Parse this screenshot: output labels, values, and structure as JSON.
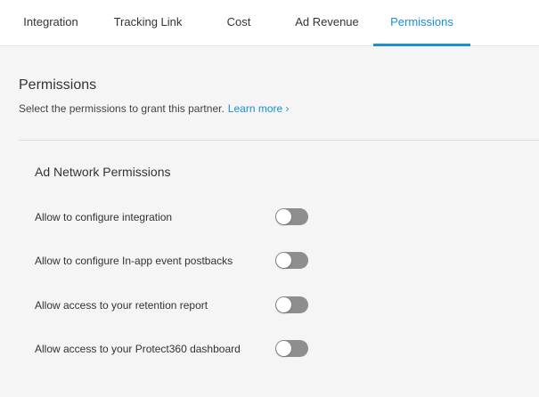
{
  "tabs": [
    {
      "label": "Integration",
      "active": false
    },
    {
      "label": "Tracking Link",
      "active": false
    },
    {
      "label": "Cost",
      "active": false
    },
    {
      "label": "Ad Revenue",
      "active": false
    },
    {
      "label": "Permissions",
      "active": true
    }
  ],
  "header": {
    "title": "Permissions",
    "subtitle": "Select the permissions to grant this partner.",
    "learn_more": "Learn more ›"
  },
  "section": {
    "title": "Ad Network Permissions",
    "permissions": [
      {
        "label": "Allow to configure integration",
        "enabled": false
      },
      {
        "label": "Allow to configure In-app event postbacks",
        "enabled": false
      },
      {
        "label": "Allow access to your retention report",
        "enabled": false
      },
      {
        "label": "Allow access to your Protect360 dashboard",
        "enabled": false
      }
    ]
  },
  "colors": {
    "accent": "#1a8fd6",
    "toggle_off": "#8e8e8e",
    "background": "#f5f5f5"
  }
}
